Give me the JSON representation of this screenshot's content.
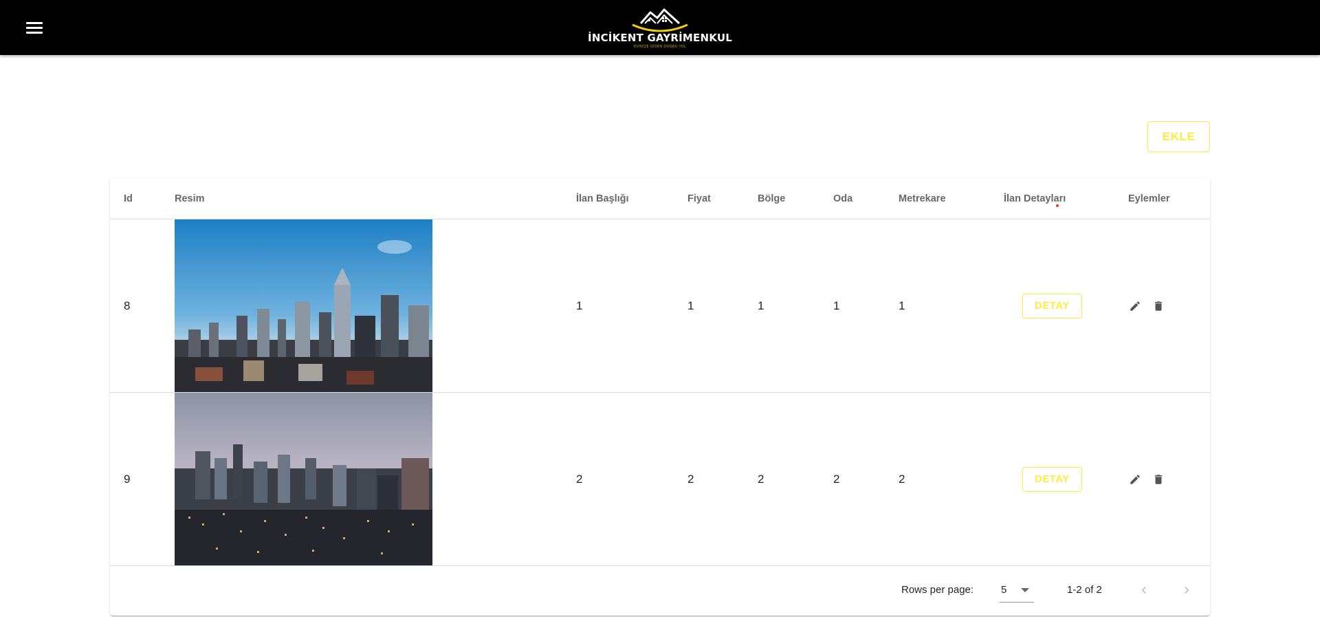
{
  "brand": {
    "name": "İNCİKENT GAYRİMENKUL",
    "tagline": "EVİNİZE GİDEN DOĞRU YOL"
  },
  "toolbar": {
    "add_label": "EKLE"
  },
  "table": {
    "headers": {
      "id": "Id",
      "image": "Resim",
      "title": "İlan Başlığı",
      "price": "Fiyat",
      "region": "Bölge",
      "rooms": "Oda",
      "area": "Metrekare",
      "details": "İlan Detayları",
      "actions": "Eylemler"
    },
    "rows": [
      {
        "id": "8",
        "image": "city-skyline-day-photo",
        "title": "1",
        "price": "1",
        "region": "1",
        "rooms": "1",
        "area": "1",
        "detail_label": "DETAY"
      },
      {
        "id": "9",
        "image": "city-skyline-dusk-photo",
        "title": "2",
        "price": "2",
        "region": "2",
        "rooms": "2",
        "area": "2",
        "detail_label": "DETAY"
      }
    ]
  },
  "pagination": {
    "rows_per_page_label": "Rows per page:",
    "rows_per_page_value": "5",
    "range_text": "1-2 of 2"
  },
  "colors": {
    "appbar": "#000000",
    "accent": "#ffeb3b",
    "logo_arc": "#f5d000"
  },
  "icons": [
    "menu-icon",
    "edit-icon",
    "delete-icon",
    "chevron-left-icon",
    "chevron-right-icon",
    "dropdown-arrow-icon"
  ]
}
